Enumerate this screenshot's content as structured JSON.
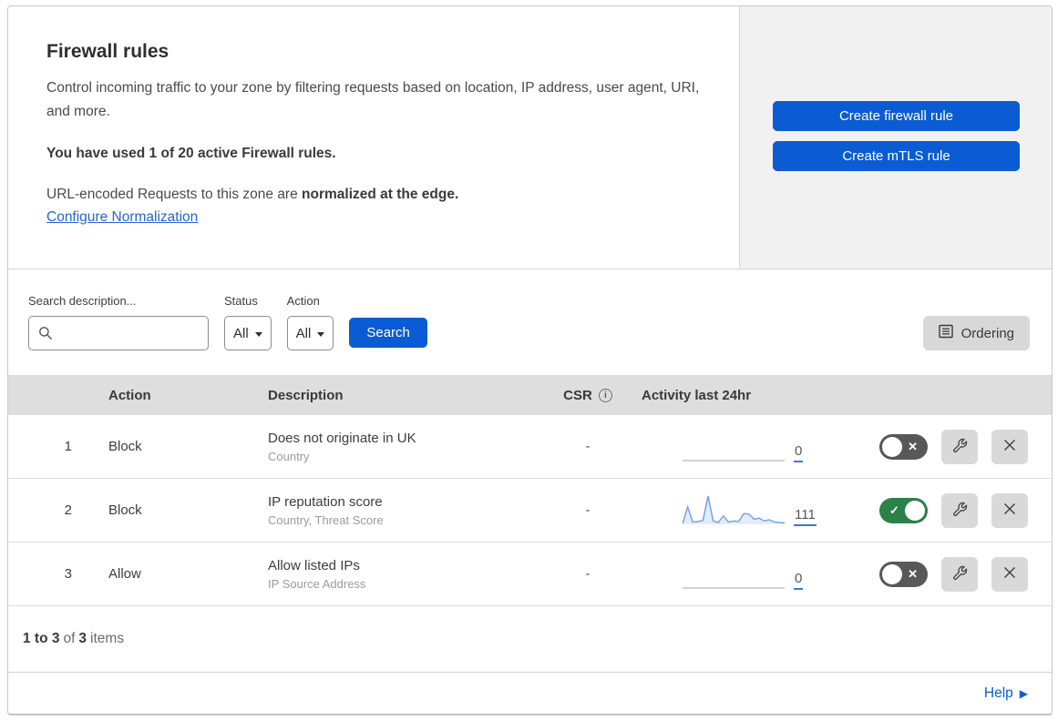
{
  "header": {
    "title": "Firewall rules",
    "description": "Control incoming traffic to your zone by filtering requests based on location, IP address, user agent, URI, and more.",
    "usage": "You have used 1 of 20 active Firewall rules.",
    "normalization_prefix": "URL-encoded Requests to this zone are ",
    "normalization_bold": "normalized at the edge.",
    "normalization_link": "Configure Normalization",
    "create_firewall_button": "Create firewall rule",
    "create_mtls_button": "Create mTLS rule"
  },
  "filters": {
    "search_label": "Search description...",
    "search_value": "",
    "status_label": "Status",
    "status_value": "All",
    "action_label": "Action",
    "action_value": "All",
    "search_button": "Search",
    "ordering_button": "Ordering"
  },
  "table": {
    "columns": {
      "action": "Action",
      "description": "Description",
      "csr": "CSR",
      "activity": "Activity last 24hr"
    },
    "rows": [
      {
        "priority": "1",
        "action": "Block",
        "description": "Does not originate in UK",
        "fields": "Country",
        "csr": "-",
        "activity_count": "0",
        "enabled": false,
        "sparkline": []
      },
      {
        "priority": "2",
        "action": "Block",
        "description": "IP reputation score",
        "fields": "Country, Threat Score",
        "csr": "-",
        "activity_count": "111",
        "enabled": true,
        "sparkline": [
          2,
          62,
          8,
          10,
          14,
          100,
          12,
          6,
          30,
          8,
          12,
          10,
          38,
          36,
          18,
          22,
          12,
          16,
          8,
          6,
          5
        ]
      },
      {
        "priority": "3",
        "action": "Allow",
        "description": "Allow listed IPs",
        "fields": "IP Source Address",
        "csr": "-",
        "activity_count": "0",
        "enabled": false,
        "sparkline": []
      }
    ],
    "footer": {
      "range": "1 to 3",
      "of_text": "of",
      "total": "3",
      "items_text": "items"
    }
  },
  "help": {
    "label": "Help"
  },
  "icons": {
    "toggle_on_check": "✓",
    "toggle_off_x": "✕",
    "help_arrow": "▶",
    "info_i": "i"
  },
  "colors": {
    "accent_blue": "#0b5cd3",
    "link_blue": "#2366d1",
    "toggle_on_green": "#2c8049",
    "toggle_off_gray": "#585858",
    "spark_line_blue": "#6f9ee8",
    "spark_fill_blue": "#e3ecfa",
    "flat_line_gray": "#c4c4c4",
    "table_header_gray": "#dedede",
    "aside_gray": "#f1f1f1"
  }
}
